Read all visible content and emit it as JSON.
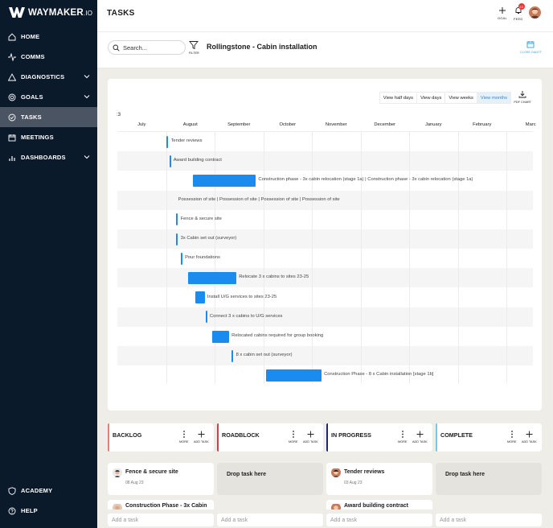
{
  "brand": {
    "name": "WAYMAKER",
    "suffix": ".IO"
  },
  "sidebar": {
    "items": [
      {
        "label": "HOME",
        "icon": "home-icon",
        "has_chevron": false,
        "active": false
      },
      {
        "label": "COMMS",
        "icon": "pulse-icon",
        "has_chevron": false,
        "active": false
      },
      {
        "label": "DIAGNOSTICS",
        "icon": "triangle-icon",
        "has_chevron": true,
        "active": false
      },
      {
        "label": "GOALS",
        "icon": "target-icon",
        "has_chevron": true,
        "active": false
      },
      {
        "label": "TASKS",
        "icon": "check-circle-icon",
        "has_chevron": false,
        "active": true
      },
      {
        "label": "MEETINGS",
        "icon": "calendar-icon",
        "has_chevron": false,
        "active": false
      },
      {
        "label": "DASHBOARDS",
        "icon": "bar-chart-icon",
        "has_chevron": true,
        "active": false
      }
    ],
    "bottom_items": [
      {
        "label": "ACADEMY",
        "icon": "shield-icon"
      },
      {
        "label": "HELP",
        "icon": "help-icon"
      }
    ]
  },
  "header": {
    "title": "TASKS",
    "goal_label": "GOAL",
    "feed_label": "FEED",
    "feed_badge": "22"
  },
  "subheader": {
    "search_placeholder": "Search...",
    "filter_label": "FILTER",
    "project_title": "Rollingstone - Cabin installation",
    "close_gantt_label": "CLOSE GANTT"
  },
  "gantt": {
    "view_buttons": [
      {
        "label": "View half days",
        "active": false
      },
      {
        "label": "View days",
        "active": false
      },
      {
        "label": "View weeks",
        "active": false
      },
      {
        "label": "View months",
        "active": true
      }
    ],
    "pdf_label": "PDF CHART",
    "scroll_label": ":3",
    "months": [
      "July",
      "August",
      "September",
      "October",
      "November",
      "December",
      "January",
      "February",
      "Marc"
    ],
    "tasks": [
      {
        "label": "Tender reviews",
        "start": 1.01,
        "end": 1.05
      },
      {
        "label": "Award building contract",
        "start": 1.07,
        "end": 1.1
      },
      {
        "label": "Construction phase - 3x cabin relocation (stage 1a) | Construction phase - 3x cabin relocation (stage 1a)",
        "start": 1.55,
        "end": 2.85
      },
      {
        "label": "Possession of site | Possession of site | Possession of site | Possession of site",
        "start": 1.2,
        "end": 1.2
      },
      {
        "label": "Fence & secure site",
        "start": 1.21,
        "end": 1.25
      },
      {
        "label": "3x Cabin set out (surveyor)",
        "start": 1.21,
        "end": 1.25
      },
      {
        "label": "Pour foundations",
        "start": 1.3,
        "end": 1.34
      },
      {
        "label": "Relocate 3 x cabins to sites 23-25",
        "start": 1.45,
        "end": 2.45
      },
      {
        "label": "Install U/G services to sites 23-25",
        "start": 1.6,
        "end": 1.8
      },
      {
        "label": "Connect 3 x cabins to U/G services",
        "start": 1.81,
        "end": 1.85
      },
      {
        "label": "Relocated cabins required for group booking",
        "start": 1.95,
        "end": 2.3
      },
      {
        "label": "8 x cabin set out (surveyor)",
        "start": 2.35,
        "end": 2.39
      },
      {
        "label": "Construction Phase - 8 x Cabin installation [stage 1b]",
        "start": 3.05,
        "end": 4.2
      }
    ]
  },
  "kanban": {
    "more_label": "MORE",
    "add_task_label": "ADD TASK",
    "add_task_placeholder": "Add a task",
    "drop_label": "Drop task here",
    "columns": [
      {
        "title": "BACKLOG",
        "accent": "#e08070"
      },
      {
        "title": "ROADBLOCK",
        "accent": "#d04040"
      },
      {
        "title": "IN PROGRESS",
        "accent": "#1b2a6b"
      },
      {
        "title": "COMPLETE",
        "accent": "#7fc4e8"
      }
    ],
    "cards": {
      "backlog": {
        "name": "Fence & secure site",
        "date": "08 Aug 23",
        "peek": "Construction Phase - 3x Cabin"
      },
      "in_progress": {
        "name": "Tender reviews",
        "date": "03 Aug 23",
        "peek": "Award building contract"
      }
    }
  }
}
